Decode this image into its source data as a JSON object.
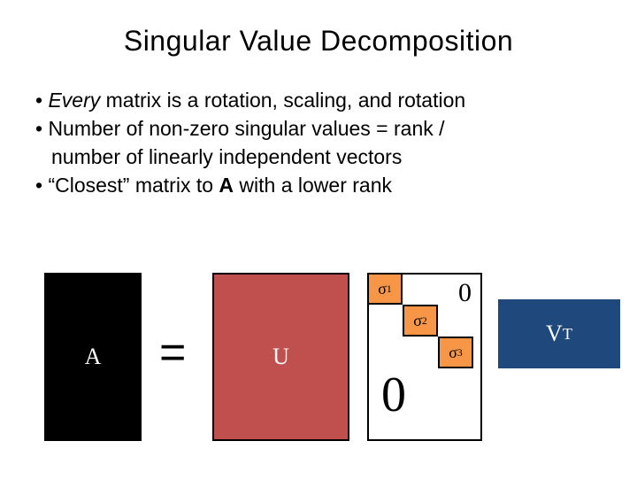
{
  "title": "Singular Value Decomposition",
  "bullets": {
    "b1_prefix": "• ",
    "b1_em": "Every",
    "b1_rest": " matrix is a rotation, scaling, and rotation",
    "b2_line1": "• Number of non-zero singular values = rank /",
    "b2_line2": "number of linearly independent vectors",
    "b3_prefix": "• “Closest” matrix to ",
    "b3_bold": "A",
    "b3_rest": " with a lower rank"
  },
  "diagram": {
    "A": "A",
    "equals": "=",
    "U": "U",
    "sigma1_sym": "σ",
    "sigma1_sub": "1",
    "sigma2_sym": "σ",
    "sigma2_sub": "2",
    "sigma3_sym": "σ",
    "sigma3_sub": "3",
    "zero_tr": "0",
    "zero_bl": "0",
    "V": "V",
    "T": "T"
  }
}
